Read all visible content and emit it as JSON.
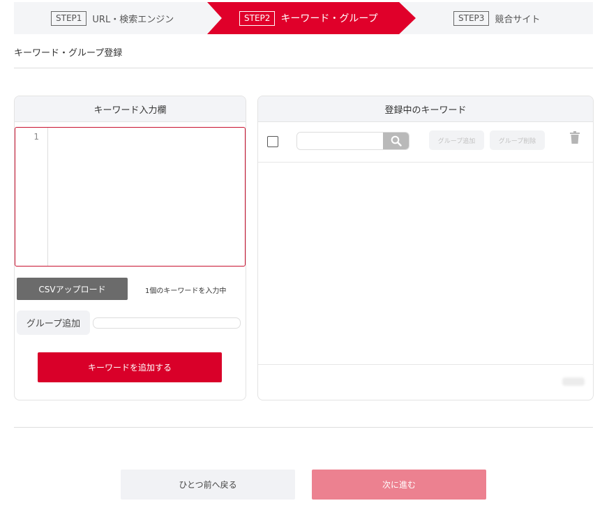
{
  "steps": [
    {
      "num": "STEP1",
      "label": "URL・検索エンジン"
    },
    {
      "num": "STEP2",
      "label": "キーワード・グループ"
    },
    {
      "num": "STEP3",
      "label": "競合サイト"
    }
  ],
  "section_title": "キーワード・グループ登録",
  "left_panel": {
    "title": "キーワード入力欄",
    "line_number": "1",
    "csv_button": "CSVアップロード",
    "keyword_count": "1個のキーワードを入力中",
    "group_add_button": "グループ追加",
    "add_keyword_button": "キーワードを追加する"
  },
  "right_panel": {
    "title": "登録中のキーワード",
    "group_add_button": "グループ追加",
    "group_delete_button": "グループ削除"
  },
  "footer": {
    "back_button": "ひとつ前へ戻る",
    "next_button": "次に進む"
  },
  "colors": {
    "accent": "#e0002a",
    "next_button_disabled": "#ec8190"
  }
}
